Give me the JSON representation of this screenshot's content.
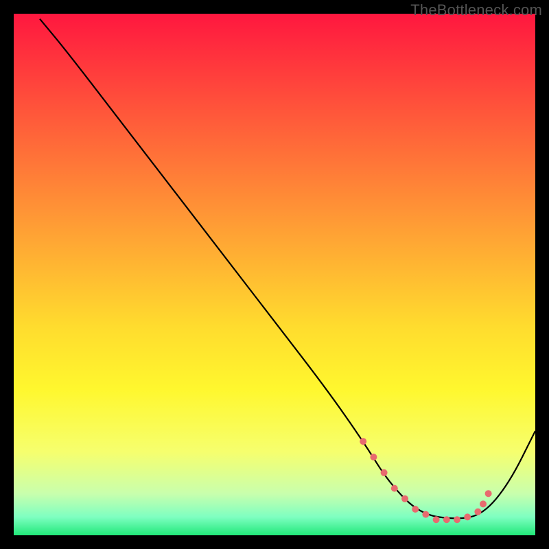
{
  "watermark": "TheBottleneck.com",
  "chart_data": {
    "type": "line",
    "title": "",
    "xlabel": "",
    "ylabel": "",
    "xlim": [
      0,
      100
    ],
    "ylim": [
      0,
      100
    ],
    "grid": false,
    "legend": false,
    "gradient_stops": [
      {
        "offset": 0.0,
        "color": "#ff173f"
      },
      {
        "offset": 0.2,
        "color": "#ff5a3a"
      },
      {
        "offset": 0.4,
        "color": "#ff9b35"
      },
      {
        "offset": 0.6,
        "color": "#ffdc2e"
      },
      {
        "offset": 0.72,
        "color": "#fff72e"
      },
      {
        "offset": 0.84,
        "color": "#f6ff6e"
      },
      {
        "offset": 0.92,
        "color": "#c9ffad"
      },
      {
        "offset": 0.965,
        "color": "#7effc1"
      },
      {
        "offset": 1.0,
        "color": "#21e879"
      }
    ],
    "series": [
      {
        "name": "bottleneck-curve",
        "color": "#000000",
        "x": [
          5,
          10,
          20,
          30,
          40,
          50,
          60,
          67,
          72,
          78,
          85,
          90,
          95,
          100
        ],
        "values": [
          99,
          93,
          80,
          67,
          54,
          41,
          28,
          18,
          10,
          4,
          3,
          4,
          10,
          20
        ]
      }
    ],
    "markers": {
      "name": "highlight-range",
      "color": "#e86a6f",
      "radius": 5,
      "x": [
        67,
        69,
        71,
        73,
        75,
        77,
        79,
        81,
        83,
        85,
        87,
        89,
        90,
        91
      ],
      "values": [
        18,
        15,
        12,
        9,
        7,
        5,
        4,
        3,
        3,
        3,
        3.5,
        4.5,
        6,
        8
      ]
    }
  }
}
